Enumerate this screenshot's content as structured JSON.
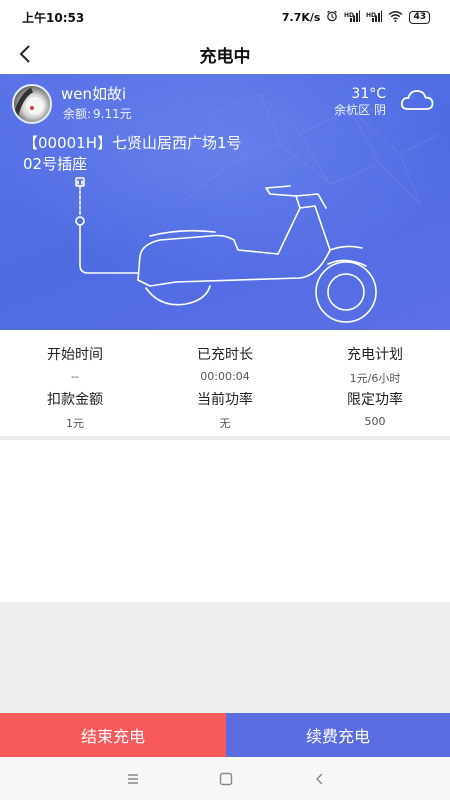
{
  "status_bar": {
    "time": "上午10:53",
    "net_speed": "7.7K/s",
    "battery": "43"
  },
  "header": {
    "title": "充电中",
    "back_icon": "chevron-left-icon"
  },
  "user": {
    "name": "wen如故i",
    "balance_label": "余额:",
    "balance_value": "9.11元"
  },
  "weather": {
    "temperature": "31°C",
    "location": "余杭区 阴",
    "icon": "cloud-icon"
  },
  "station": {
    "name": "【00001H】七贤山居西广场1号",
    "socket": "02号插座"
  },
  "stats": [
    {
      "label": "开始时间",
      "value": "--"
    },
    {
      "label": "已充时长",
      "value": "00:00:04"
    },
    {
      "label": "充电计划",
      "value": "1元/6小时"
    },
    {
      "label": "扣款金额",
      "value": "1元"
    },
    {
      "label": "当前功率",
      "value": "无"
    },
    {
      "label": "限定功率",
      "value": "500"
    }
  ],
  "actions": {
    "end_label": "结束充电",
    "renew_label": "续费充电",
    "end_color": "#f85a5a",
    "renew_color": "#5b6be0"
  },
  "theme": {
    "hero_color": "#5470e6"
  }
}
